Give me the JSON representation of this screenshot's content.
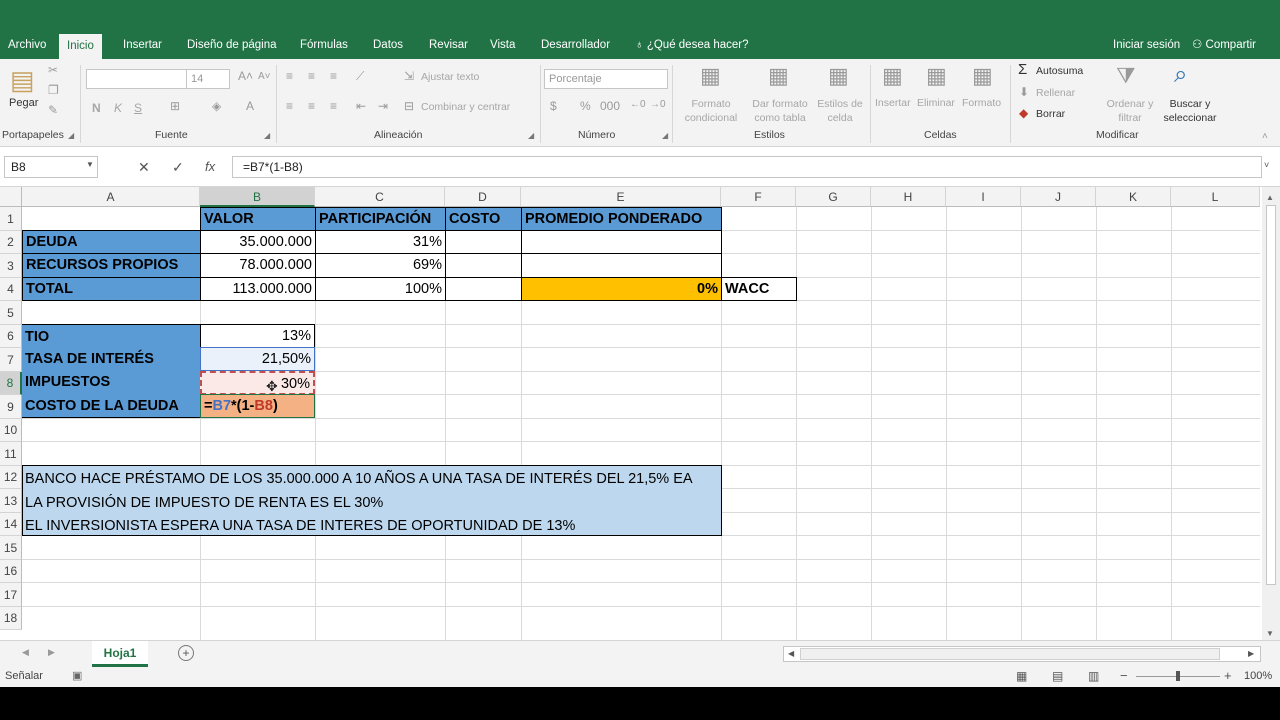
{
  "menu": {
    "tabs": [
      "Archivo",
      "Inicio",
      "Insertar",
      "Diseño de página",
      "Fórmulas",
      "Datos",
      "Revisar",
      "Vista",
      "Desarrollador"
    ],
    "tell_me": "¿Qué desea hacer?",
    "signin": "Iniciar sesión",
    "share": "Compartir"
  },
  "ribbon": {
    "clipboard": {
      "label": "Portapapeles",
      "paste": "Pegar"
    },
    "font": {
      "label": "Fuente",
      "size": "14",
      "bold": "N",
      "italic": "K",
      "underline": "S"
    },
    "alignment": {
      "label": "Alineación",
      "wrap": "Ajustar texto",
      "merge": "Combinar y centrar"
    },
    "number": {
      "label": "Número",
      "format": "Porcentaje"
    },
    "styles": {
      "label": "Estilos",
      "conditional": "Formato condicional",
      "table": "Dar formato como tabla",
      "cell": "Estilos de celda"
    },
    "cells": {
      "label": "Celdas",
      "insert": "Insertar",
      "delete": "Eliminar",
      "format": "Formato"
    },
    "editing": {
      "label": "Modificar",
      "autosum": "Autosuma",
      "fill": "Rellenar",
      "clear": "Borrar",
      "sort": "Ordenar y filtrar",
      "find": "Buscar y seleccionar"
    }
  },
  "formula_bar": {
    "name_box": "B8",
    "cancel": "✕",
    "enter": "✓",
    "fx": "fx",
    "formula": "=B7*(1-B8)"
  },
  "columns": [
    "A",
    "B",
    "C",
    "D",
    "E",
    "F",
    "G",
    "H",
    "I",
    "J",
    "K",
    "L"
  ],
  "rows": [
    "1",
    "2",
    "3",
    "4",
    "5",
    "6",
    "7",
    "8",
    "9",
    "10",
    "11",
    "12",
    "13",
    "14",
    "15",
    "16",
    "17",
    "18"
  ],
  "cells": {
    "B1": "VALOR",
    "C1": "PARTICIPACIÓN",
    "D1": "COSTO",
    "E1": "PROMEDIO PONDERADO",
    "A2": "DEUDA",
    "B2": "35.000.000",
    "C2": "31%",
    "A3": "RECURSOS PROPIOS",
    "B3": "78.000.000",
    "C3": "69%",
    "A4": "TOTAL",
    "B4": "113.000.000",
    "C4": "100%",
    "E4": "0%",
    "F4": "WACC",
    "A6": "TIO",
    "B6": "13%",
    "A7": "TASA DE INTERÉS",
    "B7": "21,50%",
    "A8": "IMPUESTOS",
    "B8": "30%",
    "A9": "COSTO DE LA DEUDA",
    "B9_parts": [
      "=",
      "B7",
      "*(1-",
      "B8",
      ")"
    ],
    "A12": "BANCO HACE PRÉSTAMO DE LOS 35.000.000 A 10 AÑOS A UNA TASA DE INTERÉS DEL 21,5% EA",
    "A13": "LA PROVISIÓN DE IMPUESTO DE RENTA ES EL 30%",
    "A14": "EL INVERSIONISTA ESPERA UNA TASA DE INTERES DE OPORTUNIDAD DE 13%"
  },
  "sheets": {
    "active": "Hoja1"
  },
  "status": {
    "mode": "Señalar",
    "zoom": "100%"
  },
  "colors": {
    "header_blue": "#5b9bd5",
    "wacc_orange": "#ffc000",
    "excel_green": "#217346",
    "note_blue": "#bdd7ee"
  }
}
